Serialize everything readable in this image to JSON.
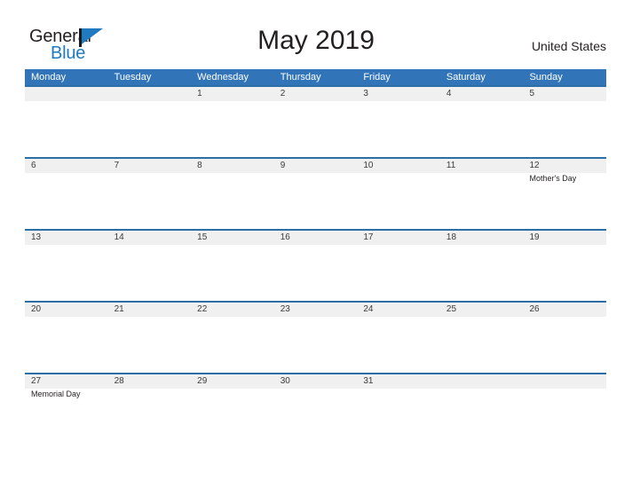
{
  "brand": {
    "name_part1": "General",
    "name_part2": "Blue",
    "flag_color": "#1f7ac0"
  },
  "header": {
    "title": "May 2019",
    "country": "United States"
  },
  "theme": {
    "header_blue": "#3175b8",
    "row_divider_blue": "#2c6ea8",
    "date_band_gray": "#f0f0f0",
    "text_dark": "#231f20"
  },
  "calendar": {
    "weekdays": [
      "Monday",
      "Tuesday",
      "Wednesday",
      "Thursday",
      "Friday",
      "Saturday",
      "Sunday"
    ],
    "weeks": [
      [
        {
          "day": "",
          "event": ""
        },
        {
          "day": "",
          "event": ""
        },
        {
          "day": "1",
          "event": ""
        },
        {
          "day": "2",
          "event": ""
        },
        {
          "day": "3",
          "event": ""
        },
        {
          "day": "4",
          "event": ""
        },
        {
          "day": "5",
          "event": ""
        }
      ],
      [
        {
          "day": "6",
          "event": ""
        },
        {
          "day": "7",
          "event": ""
        },
        {
          "day": "8",
          "event": ""
        },
        {
          "day": "9",
          "event": ""
        },
        {
          "day": "10",
          "event": ""
        },
        {
          "day": "11",
          "event": ""
        },
        {
          "day": "12",
          "event": "Mother's Day"
        }
      ],
      [
        {
          "day": "13",
          "event": ""
        },
        {
          "day": "14",
          "event": ""
        },
        {
          "day": "15",
          "event": ""
        },
        {
          "day": "16",
          "event": ""
        },
        {
          "day": "17",
          "event": ""
        },
        {
          "day": "18",
          "event": ""
        },
        {
          "day": "19",
          "event": ""
        }
      ],
      [
        {
          "day": "20",
          "event": ""
        },
        {
          "day": "21",
          "event": ""
        },
        {
          "day": "22",
          "event": ""
        },
        {
          "day": "23",
          "event": ""
        },
        {
          "day": "24",
          "event": ""
        },
        {
          "day": "25",
          "event": ""
        },
        {
          "day": "26",
          "event": ""
        }
      ],
      [
        {
          "day": "27",
          "event": "Memorial Day"
        },
        {
          "day": "28",
          "event": ""
        },
        {
          "day": "29",
          "event": ""
        },
        {
          "day": "30",
          "event": ""
        },
        {
          "day": "31",
          "event": ""
        },
        {
          "day": "",
          "event": ""
        },
        {
          "day": "",
          "event": ""
        }
      ]
    ]
  }
}
